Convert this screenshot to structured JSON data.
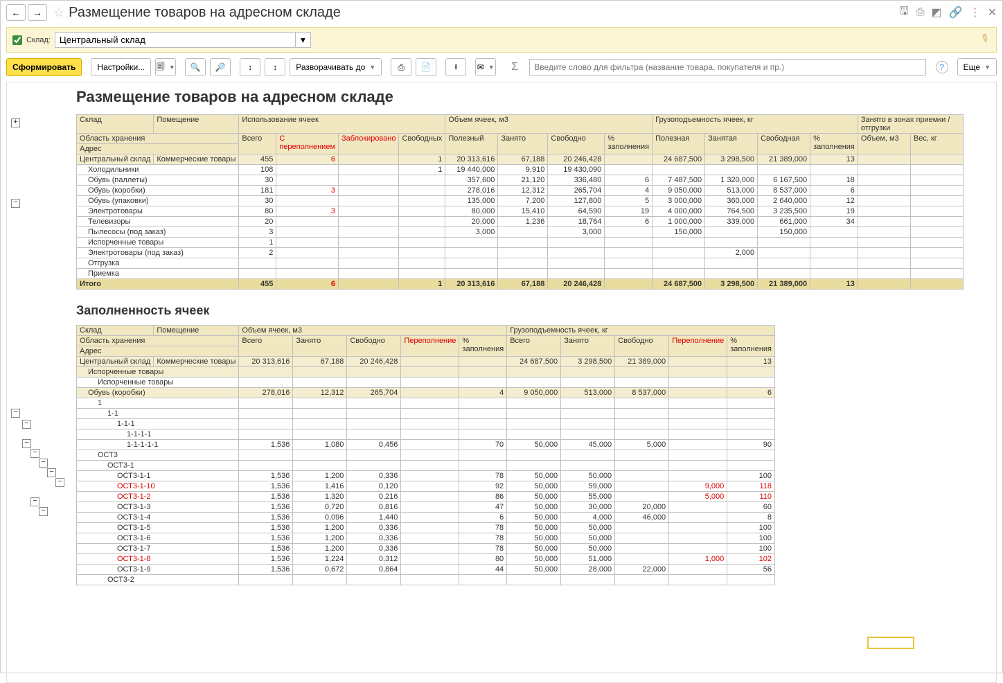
{
  "window": {
    "title": "Размещение товаров на адресном складе"
  },
  "filter": {
    "label": "Склад:",
    "value": "Центральный склад"
  },
  "toolbar": {
    "generate": "Сформировать",
    "settings": "Настройки...",
    "expand": "Разворачивать до",
    "more": "Еще",
    "filter_placeholder": "Введите слово для фильтра (название товара, покупателя и пр.)"
  },
  "report1": {
    "title": "Размещение товаров на адресном складе",
    "headers": {
      "h1": "Склад",
      "h2": "Помещение",
      "h3": "Использование ячеек",
      "h4": "Объем ячеек, м3",
      "h5": "Грузоподъемность ячеек, кг",
      "h6": "Занято в зонах приемки / отгрузки",
      "h7": "Область хранения",
      "h8": "Адрес",
      "c1": "Всего",
      "c2": "С переполнением",
      "c3": "Заблокировано",
      "c4": "Свободных",
      "c5": "Полезный",
      "c6": "Занято",
      "c7": "Свободно",
      "c8": "% заполнения",
      "c9": "Полезная",
      "c10": "Занятая",
      "c11": "Свободная",
      "c12": "% заполнения",
      "c13": "Объем, м3",
      "c14": "Вес, кг"
    },
    "rows": [
      {
        "group": true,
        "n1": "Центральный склад",
        "n2": "Коммерческие товары",
        "v": [
          "455",
          "6",
          "",
          "1",
          "20 313,616",
          "67,188",
          "20 246,428",
          "",
          "24 687,500",
          "3 298,500",
          "21 389,000",
          "13",
          "",
          ""
        ]
      },
      {
        "name": "Холодильники",
        "v": [
          "108",
          "",
          "",
          "1",
          "19 440,000",
          "9,910",
          "19 430,090",
          "",
          "",
          "",
          "",
          "",
          "",
          ""
        ]
      },
      {
        "name": "Обувь (паллеты)",
        "v": [
          "30",
          "",
          "",
          "",
          "357,600",
          "21,120",
          "336,480",
          "6",
          "7 487,500",
          "1 320,000",
          "6 167,500",
          "18",
          "",
          ""
        ]
      },
      {
        "name": "Обувь (коробки)",
        "v": [
          "181",
          "3",
          "",
          "",
          "278,016",
          "12,312",
          "265,704",
          "4",
          "9 050,000",
          "513,000",
          "8 537,000",
          "6",
          "",
          ""
        ]
      },
      {
        "name": "Обувь (упаковки)",
        "v": [
          "30",
          "",
          "",
          "",
          "135,000",
          "7,200",
          "127,800",
          "5",
          "3 000,000",
          "360,000",
          "2 640,000",
          "12",
          "",
          ""
        ]
      },
      {
        "name": "Электротовары",
        "v": [
          "80",
          "3",
          "",
          "",
          "80,000",
          "15,410",
          "64,590",
          "19",
          "4 000,000",
          "764,500",
          "3 235,500",
          "19",
          "",
          ""
        ]
      },
      {
        "name": "Телевизоры",
        "v": [
          "20",
          "",
          "",
          "",
          "20,000",
          "1,236",
          "18,764",
          "6",
          "1 000,000",
          "339,000",
          "661,000",
          "34",
          "",
          ""
        ]
      },
      {
        "name": "Пылесосы (под заказ)",
        "v": [
          "3",
          "",
          "",
          "",
          "3,000",
          "",
          "3,000",
          "",
          "150,000",
          "",
          "150,000",
          "",
          "",
          ""
        ]
      },
      {
        "name": "Испорченные товары",
        "v": [
          "1",
          "",
          "",
          "",
          "",
          "",
          "",
          "",
          "",
          "",
          "",
          "",
          "",
          ""
        ]
      },
      {
        "name": "Электротовары (под заказ)",
        "v": [
          "2",
          "",
          "",
          "",
          "",
          "",
          "",
          "",
          "",
          "2,000",
          "",
          "",
          "",
          ""
        ]
      },
      {
        "name": "Отгрузка",
        "v": [
          "",
          "",
          "",
          "",
          "",
          "",
          "",
          "",
          "",
          "",
          "",
          "",
          "",
          ""
        ]
      },
      {
        "name": "Приемка",
        "v": [
          "",
          "",
          "",
          "",
          "",
          "",
          "",
          "",
          "",
          "",
          "",
          "",
          "",
          ""
        ]
      }
    ],
    "total": {
      "label": "Итого",
      "v": [
        "455",
        "6",
        "",
        "1",
        "20 313,616",
        "67,188",
        "20 246,428",
        "",
        "24 687,500",
        "3 298,500",
        "21 389,000",
        "13",
        "",
        ""
      ]
    }
  },
  "report2": {
    "title": "Заполненность ячеек",
    "headers": {
      "h1": "Склад",
      "h2": "Помещение",
      "h3": "Объем ячеек, м3",
      "h4": "Грузоподъемность ячеек, кг",
      "h7": "Область хранения",
      "h8": "Адрес",
      "c1": "Всего",
      "c2": "Занято",
      "c3": "Свободно",
      "c4": "Переполнение",
      "c5": "% заполнения",
      "c6": "Всего",
      "c7": "Занято",
      "c8": "Свободно",
      "c9": "Переполнение",
      "c10": "% заполнения"
    },
    "rows": [
      {
        "group": true,
        "n1": "Центральный склад",
        "n2": "Коммерческие товары",
        "v": [
          "20 313,616",
          "67,188",
          "20 246,428",
          "",
          "",
          "24 687,500",
          "3 298,500",
          "21 389,000",
          "",
          "13"
        ]
      },
      {
        "group": true,
        "ind": 1,
        "name": "Испорченные товары",
        "v": [
          "",
          "",
          "",
          "",
          "",
          "",
          "",
          "",
          "",
          ""
        ]
      },
      {
        "ind": 2,
        "name": "Испорченные товары",
        "v": [
          "",
          "",
          "",
          "",
          "",
          "",
          "",
          "",
          "",
          ""
        ]
      },
      {
        "group": true,
        "ind": 1,
        "name": "Обувь (коробки)",
        "v": [
          "278,016",
          "12,312",
          "265,704",
          "",
          "4",
          "9 050,000",
          "513,000",
          "8 537,000",
          "",
          "6"
        ]
      },
      {
        "ind": 2,
        "name": "1",
        "v": [
          "",
          "",
          "",
          "",
          "",
          "",
          "",
          "",
          "",
          ""
        ]
      },
      {
        "ind": 3,
        "name": "1-1",
        "v": [
          "",
          "",
          "",
          "",
          "",
          "",
          "",
          "",
          "",
          ""
        ]
      },
      {
        "ind": 4,
        "name": "1-1-1",
        "v": [
          "",
          "",
          "",
          "",
          "",
          "",
          "",
          "",
          "",
          ""
        ]
      },
      {
        "ind": 5,
        "name": "1-1-1-1",
        "v": [
          "",
          "",
          "",
          "",
          "",
          "",
          "",
          "",
          "",
          ""
        ]
      },
      {
        "ind": 5,
        "name": "1-1-1-1-1",
        "v": [
          "1,536",
          "1,080",
          "0,456",
          "",
          "70",
          "50,000",
          "45,000",
          "5,000",
          "",
          "90"
        ]
      },
      {
        "ind": 2,
        "name": "ОСТ3",
        "v": [
          "",
          "",
          "",
          "",
          "",
          "",
          "",
          "",
          "",
          ""
        ]
      },
      {
        "ind": 3,
        "name": "ОСТ3-1",
        "v": [
          "",
          "",
          "",
          "",
          "",
          "",
          "",
          "",
          "",
          ""
        ]
      },
      {
        "ind": 4,
        "name": "ОСТ3-1-1",
        "v": [
          "1,536",
          "1,200",
          "0,336",
          "",
          "78",
          "50,000",
          "50,000",
          "",
          "",
          "100"
        ]
      },
      {
        "ind": 4,
        "name": "ОСТ3-1-10",
        "red": true,
        "v": [
          "1,536",
          "1,416",
          "0,120",
          "",
          "92",
          "50,000",
          "59,000",
          "",
          "9,000",
          "118"
        ]
      },
      {
        "ind": 4,
        "name": "ОСТ3-1-2",
        "red": true,
        "v": [
          "1,536",
          "1,320",
          "0,216",
          "",
          "86",
          "50,000",
          "55,000",
          "",
          "5,000",
          "110"
        ]
      },
      {
        "ind": 4,
        "name": "ОСТ3-1-3",
        "v": [
          "1,536",
          "0,720",
          "0,816",
          "",
          "47",
          "50,000",
          "30,000",
          "20,000",
          "",
          "60"
        ]
      },
      {
        "ind": 4,
        "name": "ОСТ3-1-4",
        "v": [
          "1,536",
          "0,096",
          "1,440",
          "",
          "6",
          "50,000",
          "4,000",
          "46,000",
          "",
          "8"
        ]
      },
      {
        "ind": 4,
        "name": "ОСТ3-1-5",
        "v": [
          "1,536",
          "1,200",
          "0,336",
          "",
          "78",
          "50,000",
          "50,000",
          "",
          "",
          "100"
        ]
      },
      {
        "ind": 4,
        "name": "ОСТ3-1-6",
        "v": [
          "1,536",
          "1,200",
          "0,336",
          "",
          "78",
          "50,000",
          "50,000",
          "",
          "",
          "100"
        ]
      },
      {
        "ind": 4,
        "name": "ОСТ3-1-7",
        "v": [
          "1,536",
          "1,200",
          "0,336",
          "",
          "78",
          "50,000",
          "50,000",
          "",
          "",
          "100"
        ]
      },
      {
        "ind": 4,
        "name": "ОСТ3-1-8",
        "red": true,
        "v": [
          "1,536",
          "1,224",
          "0,312",
          "",
          "80",
          "50,000",
          "51,000",
          "",
          "1,000",
          "102"
        ]
      },
      {
        "ind": 4,
        "name": "ОСТ3-1-9",
        "v": [
          "1,536",
          "0,672",
          "0,864",
          "",
          "44",
          "50,000",
          "28,000",
          "22,000",
          "",
          "56"
        ]
      },
      {
        "ind": 3,
        "name": "ОСТ3-2",
        "v": [
          "",
          "",
          "",
          "",
          "",
          "",
          "",
          "",
          "",
          ""
        ]
      }
    ]
  }
}
